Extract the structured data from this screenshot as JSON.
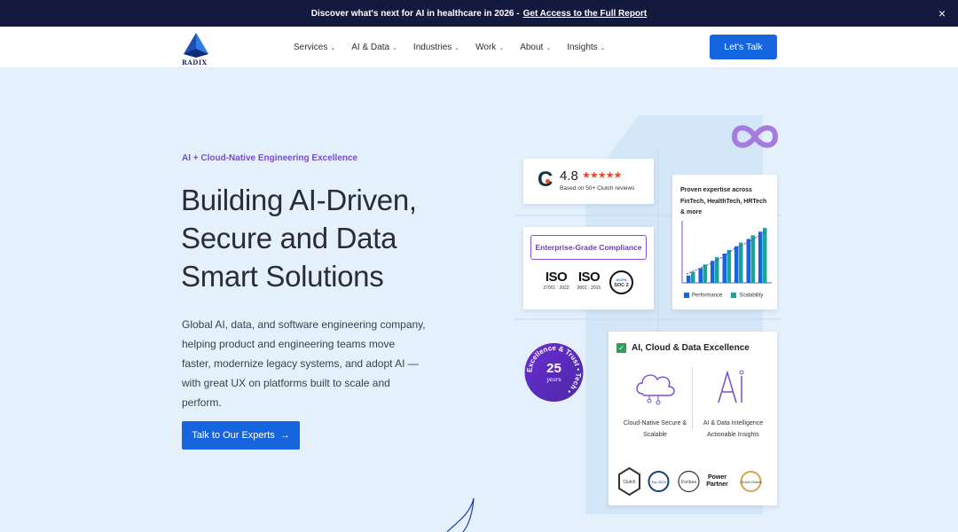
{
  "announcement": {
    "text": "Discover what's next for AI in healthcare in 2026 -",
    "link": "Get Access to the Full Report",
    "close": "×"
  },
  "header": {
    "logo_text": "RADIX",
    "nav": [
      {
        "label": "Services"
      },
      {
        "label": "AI & Data"
      },
      {
        "label": "Industries"
      },
      {
        "label": "Work"
      },
      {
        "label": "About"
      },
      {
        "label": "Insights"
      }
    ],
    "cta": "Let's Talk"
  },
  "hero": {
    "eyebrow": "AI + Cloud-Native Engineering Excellence",
    "title_lines": [
      "Building AI-Driven,",
      "Secure and Data",
      "Smart Solutions"
    ],
    "description": "Global AI, data, and software engineering company, helping product and engineering teams move faster, modernize legacy systems, and adopt AI — with great UX on platforms built to scale and perform.",
    "cta": "Talk to Our Experts",
    "cta_arrow": "→"
  },
  "rating_card": {
    "logo_letter": "C",
    "rating": "4.8",
    "stars": "★★★★★",
    "subtitle": "Based on 50+ Clutch reviews"
  },
  "compliance_card": {
    "title": "Enterprise-Grade Compliance",
    "badges": [
      {
        "mark": "ISO",
        "number": "27001 : 2022"
      },
      {
        "mark": "ISO",
        "number": "9001 : 2015"
      }
    ],
    "soc_top": "AICPA",
    "soc_label": "SOC 2"
  },
  "chart_card": {
    "title": "Proven expertise across FinTech, HealthTech, HRTech & more",
    "legend": [
      "Performance",
      "Scalability"
    ],
    "colors": {
      "performance": "#1565e0",
      "scalability": "#1aa39a"
    },
    "values": {
      "performance": [
        1,
        2,
        3,
        4,
        5,
        6,
        7
      ],
      "scalability": [
        1.5,
        2.5,
        3.5,
        4.5,
        5.5,
        6.5,
        7.5
      ]
    }
  },
  "badge_25": {
    "arc_text": "Excellence & Trust • Tech •",
    "number": "25",
    "unit": "years"
  },
  "excellence_card": {
    "check": "✓",
    "title": "AI, Cloud & Data Excellence",
    "columns": [
      {
        "label": "Cloud-Native Secure & Scalable"
      },
      {
        "label": "AI & Data Intelligence Actionable Insights"
      }
    ],
    "awards": [
      "Clutch",
      "Top 2024",
      "Forbes",
      "Power Partner",
      "Clutch Global"
    ]
  },
  "colors": {
    "accent": "#1565e0",
    "purple": "#7a4ccf",
    "announcement_bg": "#141a3d",
    "page_bg": "#e4f0fb"
  }
}
